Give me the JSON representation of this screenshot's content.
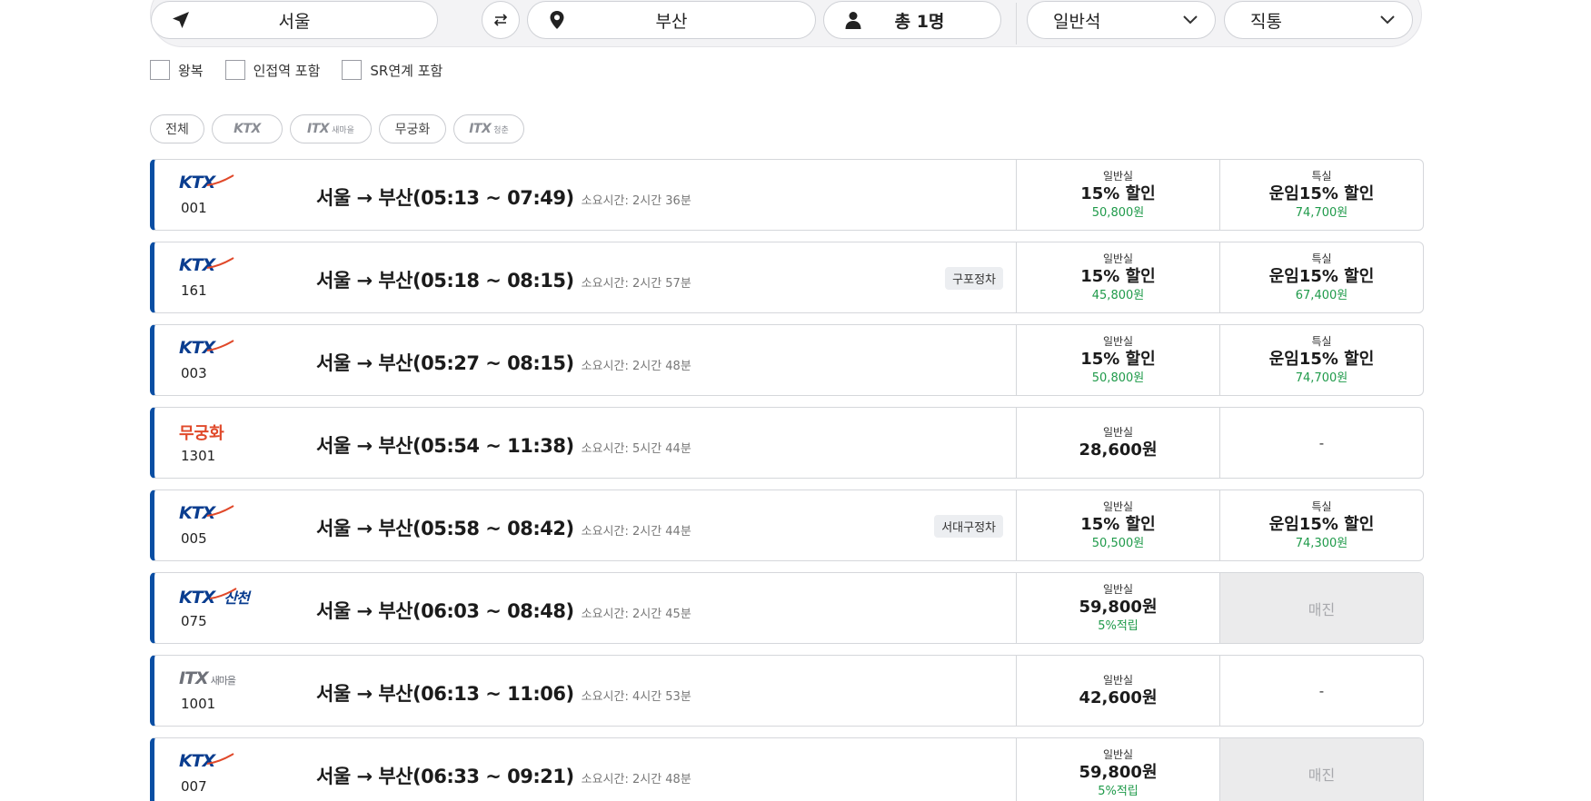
{
  "search": {
    "departure": "서울",
    "arrival": "부산",
    "passengers": "총 1명",
    "seat_class": "일반석",
    "route_type": "직통"
  },
  "options": [
    {
      "label": "왕복",
      "checked": false
    },
    {
      "label": "인접역 포함",
      "checked": false
    },
    {
      "label": "SR연계 포함",
      "checked": false
    }
  ],
  "filters": [
    {
      "label": "전체"
    },
    {
      "label": "KTX"
    },
    {
      "label": "ITX",
      "sub": "새마을"
    },
    {
      "label": "무궁화"
    },
    {
      "label": "ITX",
      "sub": "청춘"
    }
  ],
  "trains": [
    {
      "brand": "KTX",
      "number": "001",
      "route": "서울 → 부산(05:13 ~ 07:49)",
      "duration": "소요시간: 2시간 36분",
      "stop": "",
      "general": {
        "cls": "일반실",
        "main": "15% 할인",
        "price": "50,800원"
      },
      "special": {
        "cls": "특실",
        "main": "운임15% 할인",
        "price": "74,700원"
      }
    },
    {
      "brand": "KTX",
      "number": "161",
      "route": "서울 → 부산(05:18 ~ 08:15)",
      "duration": "소요시간: 2시간 57분",
      "stop": "구포정차",
      "general": {
        "cls": "일반실",
        "main": "15% 할인",
        "price": "45,800원"
      },
      "special": {
        "cls": "특실",
        "main": "운임15% 할인",
        "price": "67,400원"
      }
    },
    {
      "brand": "KTX",
      "number": "003",
      "route": "서울 → 부산(05:27 ~ 08:15)",
      "duration": "소요시간: 2시간 48분",
      "stop": "",
      "general": {
        "cls": "일반실",
        "main": "15% 할인",
        "price": "50,800원"
      },
      "special": {
        "cls": "특실",
        "main": "운임15% 할인",
        "price": "74,700원"
      }
    },
    {
      "brand": "무궁화",
      "number": "1301",
      "route": "서울 → 부산(05:54 ~ 11:38)",
      "duration": "소요시간: 5시간 44분",
      "stop": "",
      "general": {
        "cls": "일반실",
        "main": "28,600원",
        "price": ""
      },
      "special": {
        "dash": "-"
      }
    },
    {
      "brand": "KTX",
      "number": "005",
      "route": "서울 → 부산(05:58 ~ 08:42)",
      "duration": "소요시간: 2시간 44분",
      "stop": "서대구정차",
      "general": {
        "cls": "일반실",
        "main": "15% 할인",
        "price": "50,500원"
      },
      "special": {
        "cls": "특실",
        "main": "운임15% 할인",
        "price": "74,300원"
      }
    },
    {
      "brand": "KTX 산천",
      "number": "075",
      "route": "서울 → 부산(06:03 ~ 08:48)",
      "duration": "소요시간: 2시간 45분",
      "stop": "",
      "general": {
        "cls": "일반실",
        "main": "59,800원",
        "price": "5%적립"
      },
      "special": {
        "soldout": "매진"
      }
    },
    {
      "brand": "ITX 새마을",
      "number": "1001",
      "route": "서울 → 부산(06:13 ~ 11:06)",
      "duration": "소요시간: 4시간 53분",
      "stop": "",
      "general": {
        "cls": "일반실",
        "main": "42,600원",
        "price": ""
      },
      "special": {
        "dash": "-"
      }
    },
    {
      "brand": "KTX",
      "number": "007",
      "route": "서울 → 부산(06:33 ~ 09:21)",
      "duration": "소요시간: 2시간 48분",
      "stop": "",
      "general": {
        "cls": "일반실",
        "main": "59,800원",
        "price": "5%적립"
      },
      "special": {
        "soldout": "매진"
      }
    }
  ],
  "colors": {
    "accent": "#0a4ea3",
    "ktx": "#0a3d8f",
    "mugunghwa": "#e0492a",
    "price_green": "#1f9a4a",
    "soldout_bg": "#ebebec"
  }
}
